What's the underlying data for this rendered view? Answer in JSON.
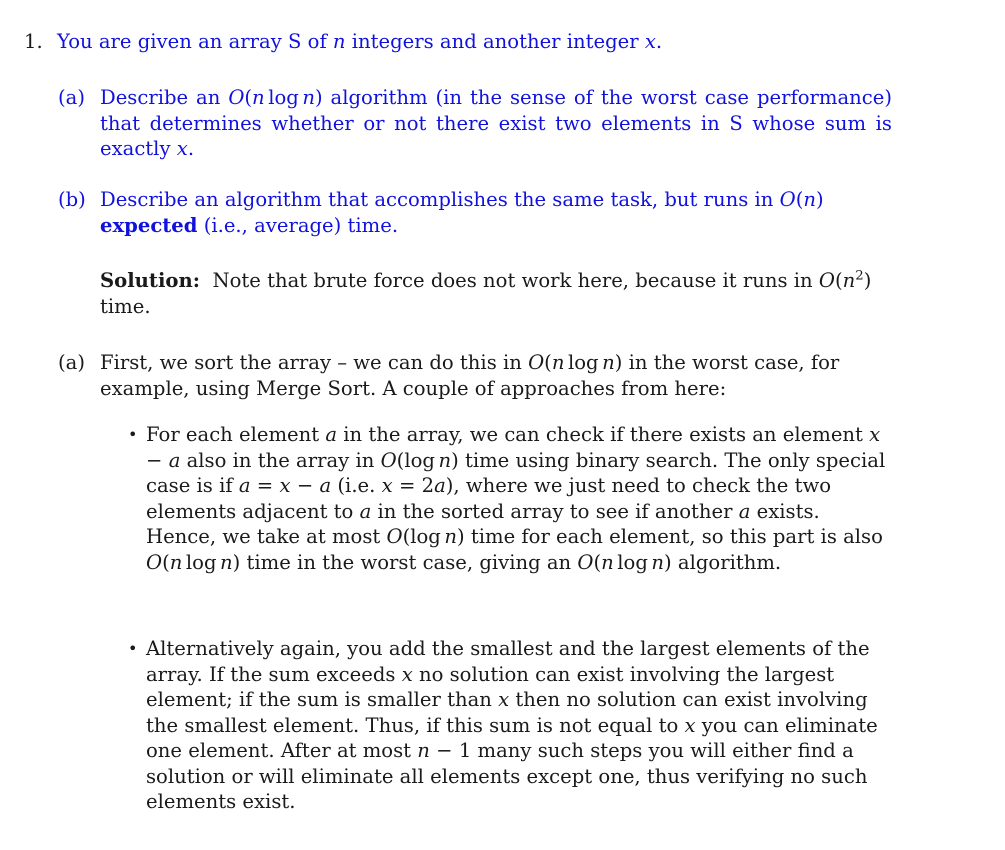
{
  "document": {
    "type": "problem-set-solution",
    "text_color_question": "#1111dd",
    "text_color_solution": "#1a1a1a"
  },
  "problem": {
    "number": "1.",
    "statement_pre": "You are given an array S of ",
    "statement_var_n": "n",
    "statement_mid": " integers and another integer ",
    "statement_var_x": "x",
    "statement_end": "."
  },
  "parts": [
    {
      "label": "(a)",
      "seg1": "Describe an ",
      "math1": "O(n log n)",
      "seg2": " algorithm (in the sense of the worst case perfor­mance) that determines whether or not there exist two elements in S whose sum is exactly ",
      "math2": "x",
      "seg3": "."
    },
    {
      "label": "(b)",
      "seg1": "Describe an algorithm that accomplishes the same task, but runs in ",
      "math1": "O(n)",
      "seg2_bold": "expected",
      "seg3": " (i.e., average) time."
    }
  ],
  "solution": {
    "heading": "Solution:",
    "intro_pre": "Note that brute force does not work here, because it runs in ",
    "intro_math": "O(n²)",
    "intro_post": " time.",
    "part_a": {
      "label": "(a)",
      "seg1": "First, we sort the array – we can do this in ",
      "math1": "O(n log n)",
      "seg2": " in the worst case, for example, using Merge Sort. A couple of approaches from here:"
    },
    "bullets": [
      {
        "marker": "•",
        "seg1": "For each element ",
        "math1": "a",
        "seg2": " in the array, we can check if there exists an element ",
        "math2": "x − a",
        "seg3": " also in the array in ",
        "math3": "O(log n)",
        "seg4": " time using binary search. The only special case is if ",
        "math4": "a = x − a",
        "seg5": " (i.e. ",
        "math5": "x = 2a",
        "seg6": "), where we just need to check the two elements adjacent to ",
        "math6": "a",
        "seg7": " in the sorted array to see if another ",
        "math7": "a",
        "seg8": " exists. Hence, we take at most ",
        "math8": "O(log n)",
        "seg9": " time for each element, so this part is also ",
        "math9": "O(n log n)",
        "seg10": " time in the worst case, giving an ",
        "math10": "O(n log n)",
        "seg11": " algorithm."
      },
      {
        "marker": "•",
        "seg1": "Alternatively again, you add the smallest and the largest elements of the array. If the sum exceeds ",
        "math1": "x",
        "seg2": " no solution can exist involving the largest element; if the sum is smaller than ",
        "math2": "x",
        "seg3": " then no solution can exist involving the smallest element. Thus, if this sum is not equal to ",
        "math3": "x",
        "seg4": " you can eliminate one element. After at most ",
        "math4": "n − 1",
        "seg5": " many such steps you will either find a solution or will eliminate all elements except one, thus verifying no such elements exist."
      }
    ]
  },
  "math_symbols": {
    "O": "O",
    "n": "n",
    "x": "x",
    "a": "a",
    "log": "log",
    "two": "2",
    "one": "1",
    "minus": "−",
    "equals": "=",
    "lparen": "(",
    "rparen": ")",
    "superscript_two": "2"
  }
}
